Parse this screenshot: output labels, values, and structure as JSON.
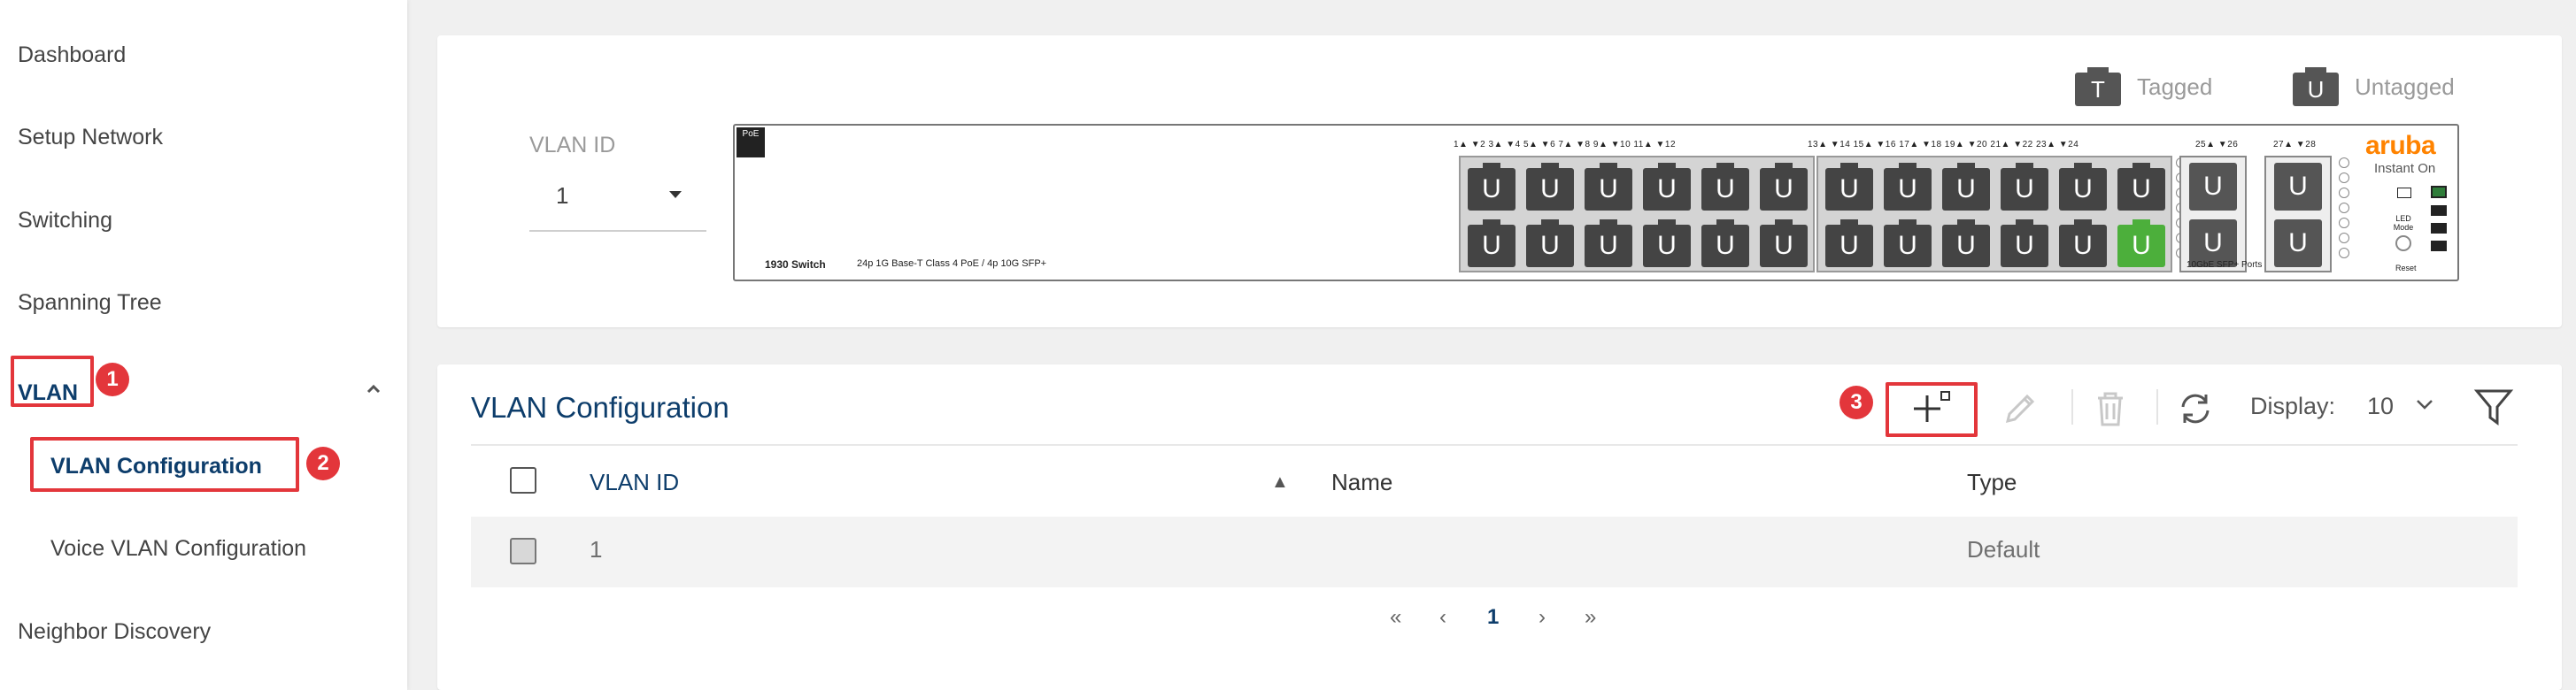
{
  "sidebar": {
    "items": [
      {
        "label": "Dashboard"
      },
      {
        "label": "Setup Network"
      },
      {
        "label": "Switching"
      },
      {
        "label": "Spanning Tree"
      },
      {
        "label": "VLAN"
      },
      {
        "label": "VLAN Configuration"
      },
      {
        "label": "Voice VLAN Configuration"
      },
      {
        "label": "Neighbor Discovery"
      }
    ]
  },
  "annotations": {
    "step1": "1",
    "step2": "2",
    "step3": "3"
  },
  "legend": {
    "tagged_glyph": "T",
    "tagged_label": "Tagged",
    "untagged_glyph": "U",
    "untagged_label": "Untagged"
  },
  "vlan_select": {
    "label": "VLAN ID",
    "value": "1"
  },
  "switch_panel": {
    "poe_badge": "PoE",
    "model": "1930 Switch",
    "description": "24p 1G Base-T Class 4 PoE / 4p 10G SFP+",
    "port_numbers_group1": "1▲ ▼2 3▲ ▼4 5▲ ▼6 7▲ ▼8 9▲ ▼10 11▲ ▼12",
    "port_numbers_group2": "13▲ ▼14 15▲ ▼16 17▲ ▼18 19▲ ▼20 21▲ ▼22 23▲ ▼24",
    "sfp_labels_a": "25▲ ▼26",
    "sfp_labels_b": "27▲ ▼28",
    "sfp_caption": "10GbE SFP+ Ports",
    "port_glyph": "U",
    "brand": "aruba",
    "brand_sub": "Instant On",
    "led_mode": "LED Mode",
    "reset": "Reset",
    "port_colors": {
      "default": "#444444",
      "active": "#4caf3b"
    },
    "active_port": "24"
  },
  "vlan_config": {
    "title": "VLAN Configuration",
    "toolbar": {
      "add": "add-icon",
      "edit": "pencil-icon",
      "delete": "trash-icon",
      "refresh": "refresh-icon",
      "display_label": "Display:",
      "display_value": "10",
      "filter": "filter-icon"
    },
    "columns": [
      "VLAN ID",
      "Name",
      "Type"
    ],
    "sort_indicator": "▲",
    "rows": [
      {
        "vlan_id": "1",
        "name": "",
        "type": "Default"
      }
    ],
    "pagination": {
      "first": "«",
      "prev": "‹",
      "current": "1",
      "next": "›",
      "last": "»"
    }
  },
  "colors": {
    "accent_navy": "#0d3d6b",
    "highlight_red": "#e3363b",
    "aruba_orange": "#ff8300"
  }
}
